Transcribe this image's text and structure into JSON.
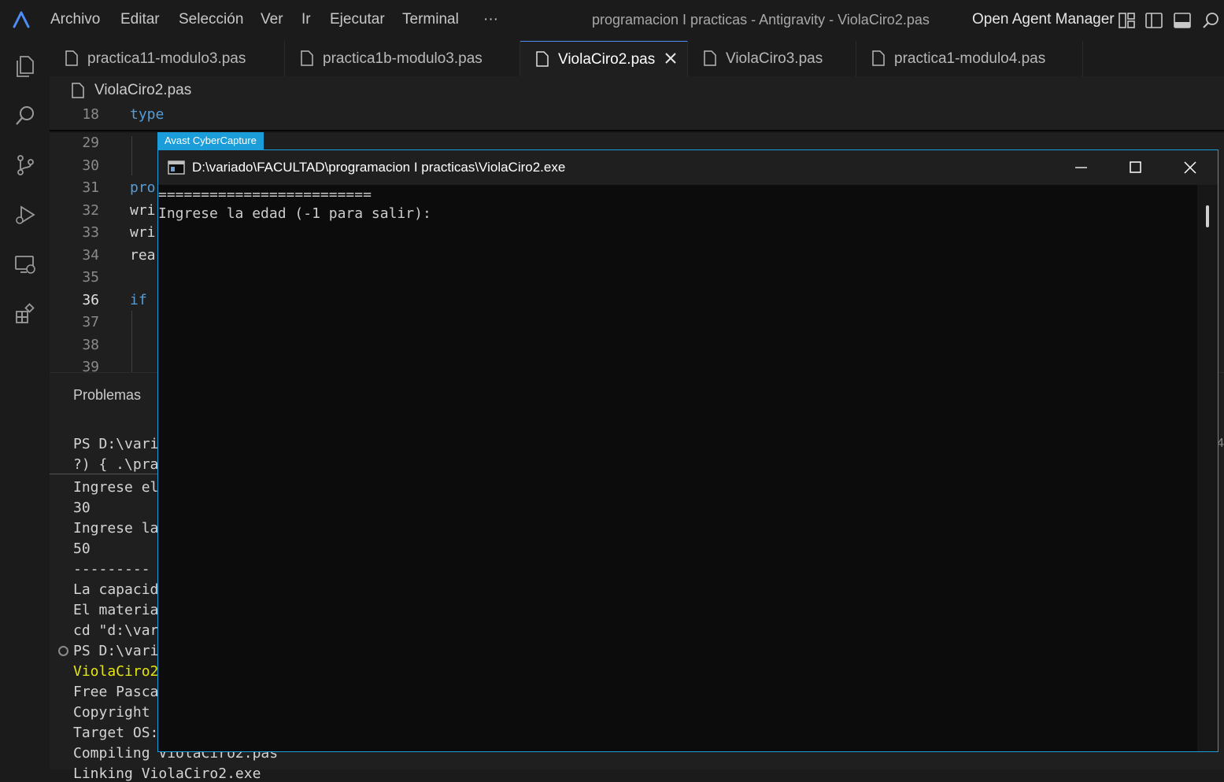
{
  "menu": [
    "Archivo",
    "Editar",
    "Selección",
    "Ver",
    "Ir",
    "Ejecutar",
    "Terminal",
    "···"
  ],
  "window_title": "programacion I practicas - Antigravity - ViolaCiro2.pas",
  "agent_manager_label": "Open Agent Manager",
  "tabs": [
    {
      "label": "practica11-modulo3.pas"
    },
    {
      "label": "practica1b-modulo3.pas"
    },
    {
      "label": "ViolaCiro2.pas",
      "active": true
    },
    {
      "label": "ViolaCiro3.pas"
    },
    {
      "label": "practica1-modulo4.pas"
    }
  ],
  "breadcrumb": "ViolaCiro2.pas",
  "editor": {
    "sticky_line": {
      "number": "18",
      "text": "type"
    },
    "lines": [
      {
        "number": "29",
        "text": ""
      },
      {
        "number": "30",
        "text": ""
      },
      {
        "number": "31",
        "text": "pro"
      },
      {
        "number": "32",
        "text": "wri"
      },
      {
        "number": "33",
        "text": "wri"
      },
      {
        "number": "34",
        "text": "rea"
      },
      {
        "number": "35",
        "text": ""
      },
      {
        "number": "36",
        "text": "if"
      },
      {
        "number": "37",
        "text": ""
      },
      {
        "number": "38",
        "text": ""
      },
      {
        "number": "39",
        "text": ""
      }
    ],
    "current_line": "36"
  },
  "panel": {
    "title": "Problemas",
    "terminal_lines": [
      "PS D:\\vari",
      "?) { .\\pra",
      "Ingrese el",
      "30",
      "Ingrese la",
      "50",
      "---------",
      "La capacid",
      "El materia",
      "cd \"d:\\var",
      "PS D:\\vari",
      "ViolaCiro2",
      "Free Pasca",
      "Copyright",
      "Target OS:",
      "Compiling ViolaCiro2.pas",
      "Linking ViolaCiro2.exe"
    ]
  },
  "edge_text": "4",
  "avast_label": "Avast CyberCapture",
  "console": {
    "title": "D:\\variado\\FACULTAD\\programacion I practicas\\ViolaCiro2.exe",
    "lines": [
      "=========================",
      "Ingrese la edad (-1 para salir):"
    ]
  },
  "colors": {
    "accent": "#4d8ef7",
    "avast": "#1a9dd9",
    "keyword": "#569cd6",
    "terminal_yellow": "#e5e510"
  }
}
